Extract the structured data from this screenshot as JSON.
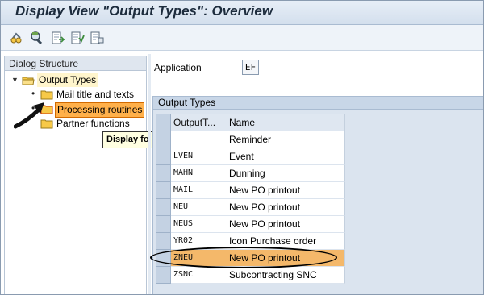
{
  "window": {
    "title": "Display View \"Output Types\": Overview"
  },
  "toolbar": {
    "buttons": [
      {
        "icon": "glasses-change-icon"
      },
      {
        "icon": "find-icon"
      },
      {
        "icon": "export-icon"
      },
      {
        "icon": "select-all-icon"
      },
      {
        "icon": "deselect-icon"
      }
    ]
  },
  "dialog_structure": {
    "header": "Dialog Structure",
    "nodes": [
      {
        "label": "Output Types",
        "level": 0,
        "expanded": true,
        "selected": true
      },
      {
        "label": "Mail title and texts",
        "level": 1
      },
      {
        "label": "Processing routines",
        "level": 1,
        "hovered": true
      },
      {
        "label": "Partner functions",
        "level": 1
      }
    ],
    "tooltip": "Display folder contents"
  },
  "application": {
    "label": "Application",
    "value": "EF"
  },
  "output_types": {
    "group_title": "Output Types",
    "columns": [
      "OutputT...",
      "Name"
    ],
    "rows": [
      {
        "code": "",
        "name": "Reminder"
      },
      {
        "code": "LVEN",
        "name": "Event"
      },
      {
        "code": "MAHN",
        "name": "Dunning"
      },
      {
        "code": "MAIL",
        "name": "New PO printout"
      },
      {
        "code": "NEU",
        "name": "New PO printout"
      },
      {
        "code": "NEUS",
        "name": "New PO printout"
      },
      {
        "code": "YR02",
        "name": "Icon Purchase order"
      },
      {
        "code": "ZNEU",
        "name": "New PO printout",
        "highlighted": true
      },
      {
        "code": "ZSNC",
        "name": "Subcontracting SNC"
      }
    ]
  },
  "colors": {
    "title_text": "#1d2c3d",
    "highlight_row": "#f4b86a",
    "folder_yellow": "#f7c948",
    "hover_node": "#ffb04a",
    "tooltip_bg": "#ffffe1"
  }
}
